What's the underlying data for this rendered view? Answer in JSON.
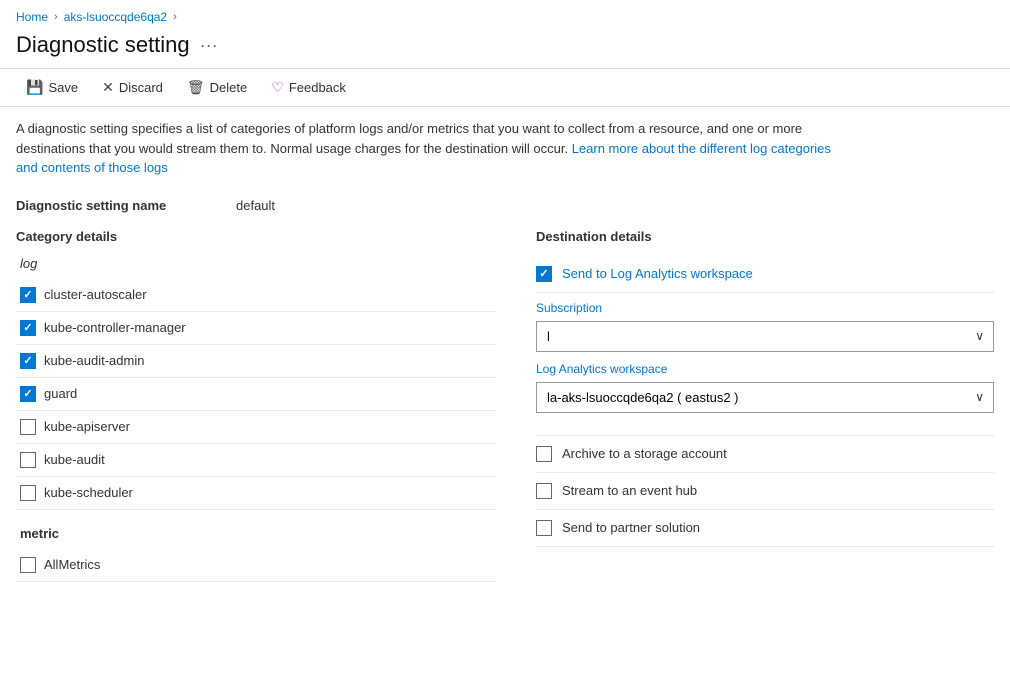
{
  "breadcrumb": {
    "items": [
      {
        "label": "Home",
        "href": "#"
      },
      {
        "label": "aks-lsuoccqde6qa2",
        "href": "#"
      }
    ]
  },
  "header": {
    "title": "Diagnostic setting",
    "menu_icon": "···"
  },
  "toolbar": {
    "save_label": "Save",
    "discard_label": "Discard",
    "delete_label": "Delete",
    "feedback_label": "Feedback"
  },
  "description": {
    "text1": "A diagnostic setting specifies a list of categories of platform logs and/or metrics that you want to collect from a resource, and one or more destinations that you would stream them to. Normal usage charges for the destination will occur. ",
    "link_text": "Learn more about the different log categories and contents of those logs",
    "link_href": "#"
  },
  "setting_name": {
    "label": "Diagnostic setting name",
    "value": "default"
  },
  "category_details": {
    "title": "Category details",
    "log_section": {
      "title": "log",
      "items": [
        {
          "id": "cluster-autoscaler",
          "label": "cluster-autoscaler",
          "checked": true
        },
        {
          "id": "kube-controller-manager",
          "label": "kube-controller-manager",
          "checked": true
        },
        {
          "id": "kube-audit-admin",
          "label": "kube-audit-admin",
          "checked": true
        },
        {
          "id": "guard",
          "label": "guard",
          "checked": true
        },
        {
          "id": "kube-apiserver",
          "label": "kube-apiserver",
          "checked": false
        },
        {
          "id": "kube-audit",
          "label": "kube-audit",
          "checked": false
        },
        {
          "id": "kube-scheduler",
          "label": "kube-scheduler",
          "checked": false
        }
      ]
    },
    "metric_section": {
      "title": "metric",
      "items": [
        {
          "id": "AllMetrics",
          "label": "AllMetrics",
          "checked": false
        }
      ]
    }
  },
  "destination_details": {
    "title": "Destination details",
    "options": [
      {
        "id": "log-analytics",
        "label": "Send to Log Analytics workspace",
        "checked": true,
        "sub": {
          "subscription_label": "Subscription",
          "subscription_value": "l",
          "workspace_label": "Log Analytics workspace",
          "workspace_value": "la-aks-lsuoccqde6qa2 ( eastus2 )"
        }
      },
      {
        "id": "storage-account",
        "label": "Archive to a storage account",
        "checked": false
      },
      {
        "id": "event-hub",
        "label": "Stream to an event hub",
        "checked": false
      },
      {
        "id": "partner-solution",
        "label": "Send to partner solution",
        "checked": false
      }
    ]
  }
}
